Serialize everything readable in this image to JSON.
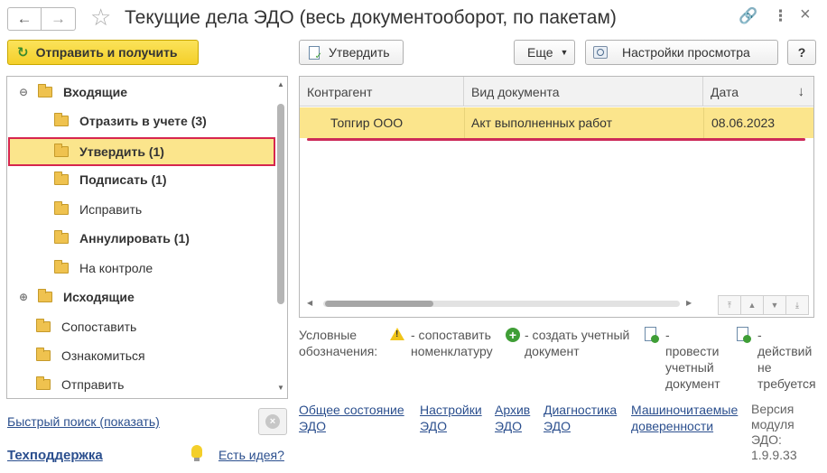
{
  "window": {
    "title": "Текущие дела ЭДО (весь документооборот, по пакетам)",
    "back": "←",
    "forward": "→",
    "star": "☆",
    "link_icon": "🔗",
    "menu_icon": "⋮",
    "close_icon": "×"
  },
  "toolbar": {
    "send_receive": "Отправить и получить",
    "approve": "Утвердить",
    "more": "Еще",
    "view_settings": "Настройки просмотра",
    "help": "?"
  },
  "tree": {
    "incoming": "Входящие",
    "reflect": "Отразить в учете (3)",
    "approve": "Утвердить (1)",
    "sign": "Подписать (1)",
    "correct": "Исправить",
    "annul": "Аннулировать (1)",
    "control": "На контроле",
    "outgoing": "Исходящие",
    "compare": "Сопоставить",
    "review": "Ознакомиться",
    "send": "Отправить"
  },
  "grid": {
    "columns": [
      "Контрагент",
      "Вид документа",
      "Дата"
    ],
    "sort_icon": "↓",
    "rows": [
      {
        "counterparty": "Топгир ООО",
        "doc_type": "Акт выполненных работ",
        "date": "08.06.2023"
      }
    ]
  },
  "legend": {
    "label": [
      "Условные",
      "обозначения:"
    ],
    "compare": [
      "- сопоставить",
      "номенклатуру"
    ],
    "create": [
      "- создать учетный",
      "документ"
    ],
    "post": [
      "-",
      "провести",
      "учетный",
      "документ"
    ],
    "noaction": [
      "-",
      "действий",
      "не",
      "требуется"
    ]
  },
  "links": {
    "general_state": [
      "Общее состояние",
      "ЭДО"
    ],
    "settings": [
      "Настройки",
      "ЭДО"
    ],
    "archive": [
      "Архив",
      "ЭДО"
    ],
    "diagnostics": [
      "Диагностика",
      "ЭДО"
    ],
    "poa": [
      "Машиночитаемые",
      "доверенности"
    ],
    "version": [
      "Версия",
      "модуля",
      "ЭДО:",
      "1.9.9.33"
    ]
  },
  "footer": {
    "quick_search": "Быстрый поиск (показать)",
    "support": "Техподдержка",
    "idea": "Есть идея?"
  },
  "colors": {
    "accent_yellow": "#f4cf2a",
    "selection": "#fbe58c",
    "highlight_red": "#d6264e",
    "link": "#2b4f8e"
  }
}
